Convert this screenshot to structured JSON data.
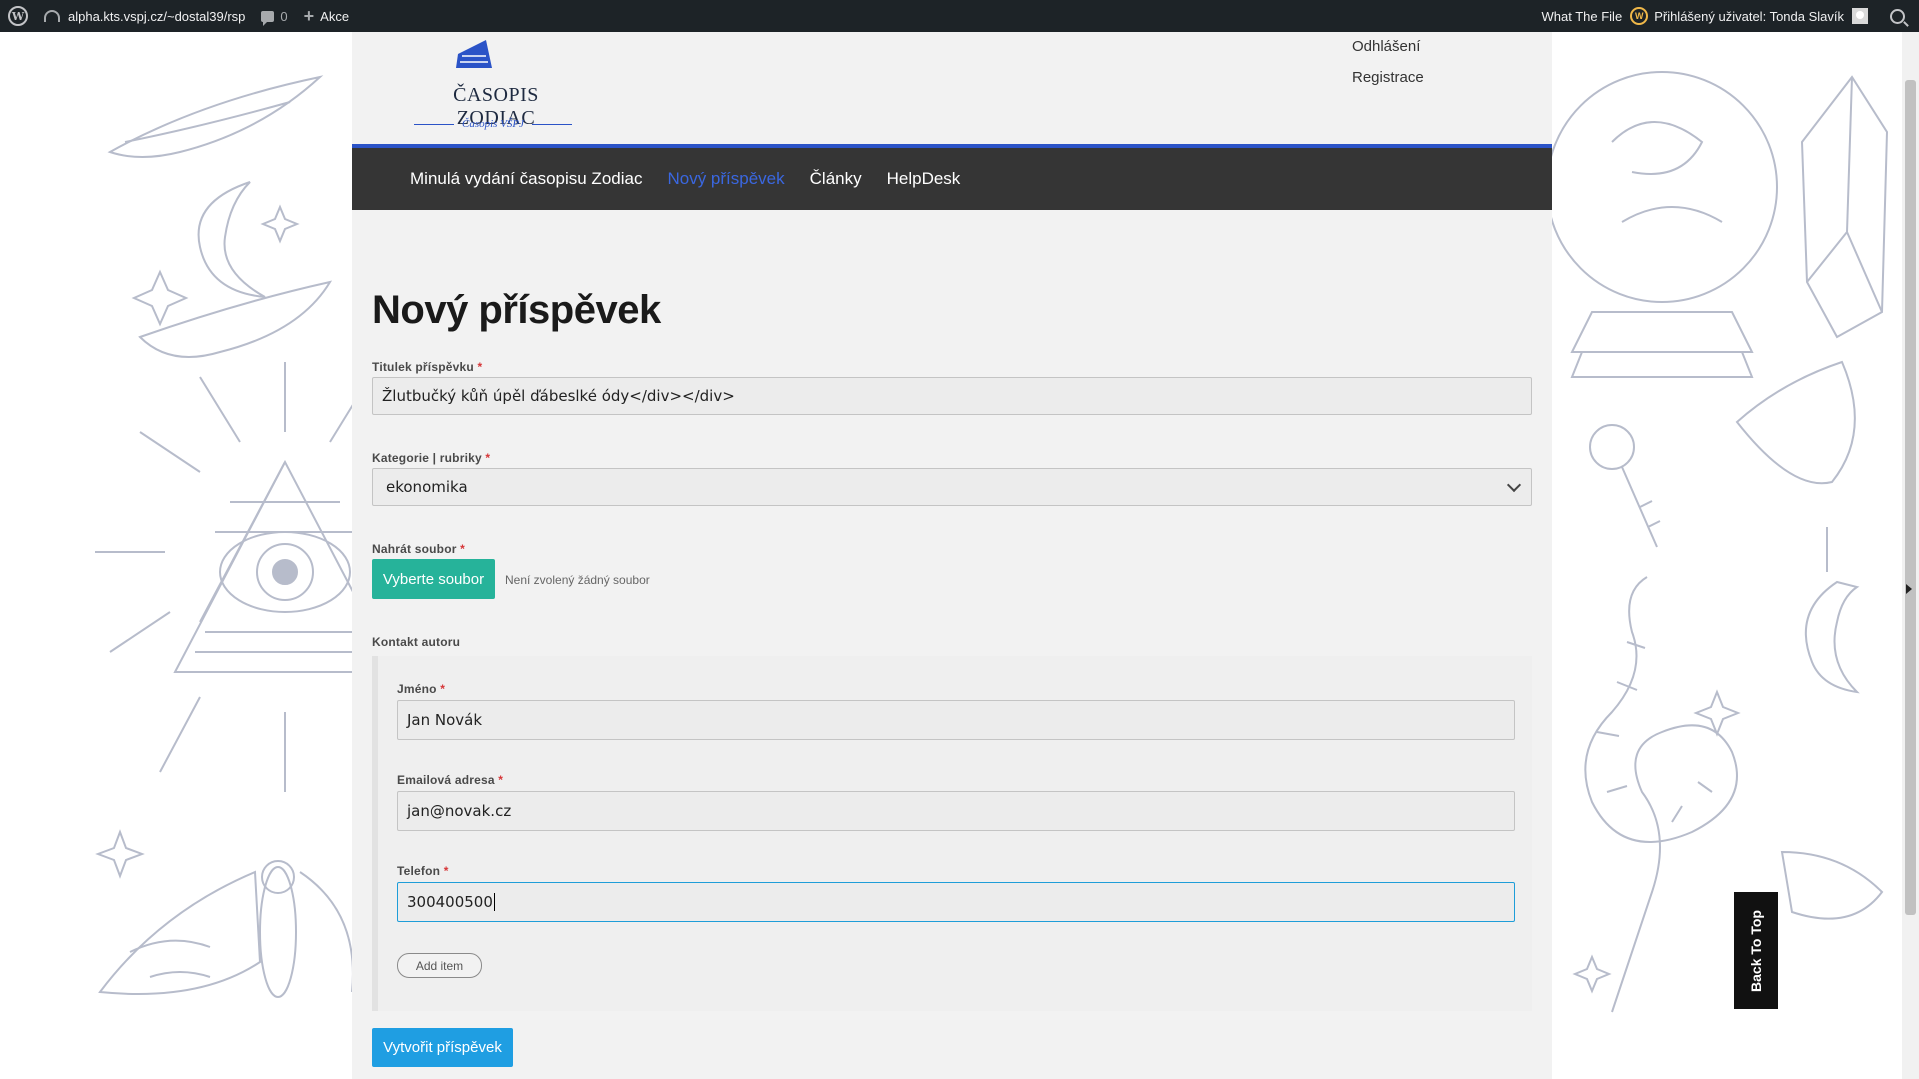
{
  "adminbar": {
    "site_name": "alpha.kts.vspj.cz/~dostal39/rsp",
    "comments_count": "0",
    "new_label": "Akce",
    "plugin_label": "What The File",
    "user_greeting": "Přihlášený uživatel: Tonda Slavík"
  },
  "header": {
    "logo_title": "ČASOPIS ZODIAC",
    "logo_subtitle": "Časopis VŠPJ",
    "links": [
      "Odhlášení",
      "Registrace"
    ]
  },
  "nav": {
    "items": [
      {
        "label": "Minulá vydání časopisu Zodiac",
        "active": false
      },
      {
        "label": "Nový příspěvek",
        "active": true
      },
      {
        "label": "Články",
        "active": false
      },
      {
        "label": "HelpDesk",
        "active": false
      }
    ],
    "active_color": "#3a67e0"
  },
  "form": {
    "page_title": "Nový příspěvek",
    "title_label": "Titulek příspěvku",
    "title_value": "Žlutbučký kůň úpěl ďábeslké ódy</div></div>",
    "category_label": "Kategorie | rubriky",
    "category_value": "ekonomika",
    "file_label": "Nahrát soubor",
    "file_button": "Vyberte soubor",
    "file_status": "Není zvolený žádný soubor",
    "contact_label": "Kontakt autoru",
    "name_label": "Jméno",
    "name_value": "Jan Novák",
    "email_label": "Emailová adresa",
    "email_value": "jan@novak.cz",
    "phone_label": "Telefon",
    "phone_value": "300400500",
    "add_item": "Add item",
    "submit": "Vytvořit příspěvek",
    "required_mark": "*"
  },
  "back_to_top": "Back To Top",
  "colors": {
    "accent_blue": "#2b53c7",
    "file_button": "#26b39a",
    "submit_button": "#1f9ee2",
    "nav_bg": "#353535"
  }
}
